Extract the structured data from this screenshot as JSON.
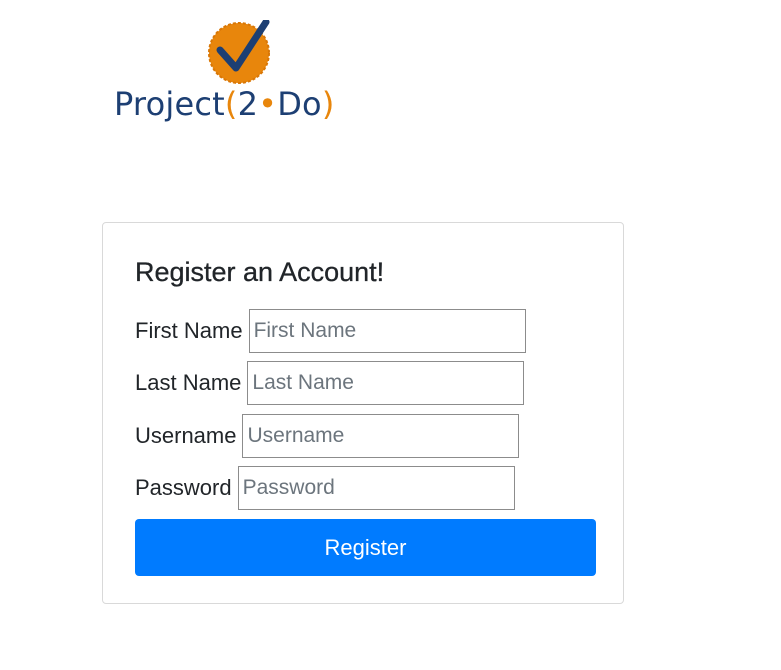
{
  "logo": {
    "text_main": "Project",
    "text_open": "(",
    "text_two": "2",
    "text_dot": "•",
    "text_do": "Do",
    "text_close": ")",
    "badge_color": "#e8860c",
    "check_color": "#1d3f73",
    "icon": "checkmark-badge-icon"
  },
  "form": {
    "title": "Register an Account!",
    "fields": [
      {
        "label": "First Name",
        "placeholder": "First Name",
        "value": ""
      },
      {
        "label": "Last Name",
        "placeholder": "Last Name",
        "value": ""
      },
      {
        "label": "Username",
        "placeholder": "Username",
        "value": ""
      },
      {
        "label": "Password",
        "placeholder": "Password",
        "value": ""
      }
    ],
    "submit_label": "Register",
    "accent_color": "#007bff"
  }
}
